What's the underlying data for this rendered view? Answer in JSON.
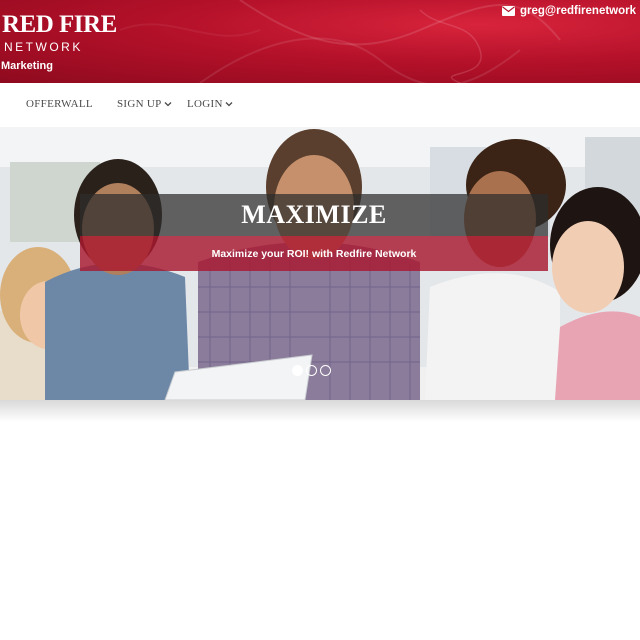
{
  "header": {
    "logo_main": "RED FIRE",
    "logo_sub": "NETWORK",
    "logo_tagline": "Marketing",
    "contact_email": "greg@redfirenetwork",
    "envelope_icon": "envelope-icon",
    "colors": {
      "brand_red": "#b5112a",
      "white": "#ffffff"
    }
  },
  "nav": {
    "items": [
      {
        "label": "OFFERWALL"
      },
      {
        "label": "SIGN UP"
      },
      {
        "label": "LOGIN"
      }
    ],
    "dropdown_icon": "chevron-down-icon"
  },
  "hero": {
    "title": "MAXIMIZE",
    "subtitle": "Maximize your ROI! with Redfire Network",
    "slides": 3,
    "active_slide": 1,
    "colors": {
      "title_band": "#2d2d2d",
      "subtitle_band": "#aa1830"
    }
  }
}
